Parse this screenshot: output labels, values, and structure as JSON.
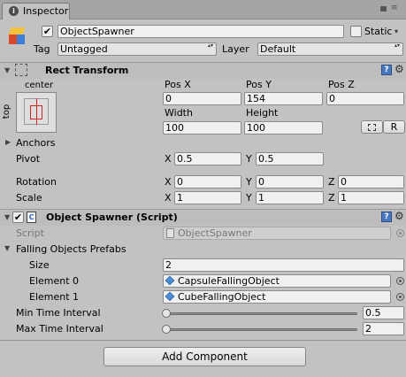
{
  "tab": {
    "title": "Inspector"
  },
  "header": {
    "object_name": "ObjectSpawner",
    "active_checked": "✔",
    "static_label": "Static",
    "tag_label": "Tag",
    "tag_value": "Untagged",
    "layer_label": "Layer",
    "layer_value": "Default"
  },
  "rect_transform": {
    "title": "Rect Transform",
    "anchor_preset_h": "center",
    "anchor_preset_v": "top",
    "pos_x_label": "Pos X",
    "pos_x": "0",
    "pos_y_label": "Pos Y",
    "pos_y": "154",
    "pos_z_label": "Pos Z",
    "pos_z": "0",
    "width_label": "Width",
    "width": "100",
    "height_label": "Height",
    "height": "100",
    "raw_button": "R",
    "anchors_label": "Anchors",
    "pivot_label": "Pivot",
    "pivot_x_label": "X",
    "pivot_x": "0.5",
    "pivot_y_label": "Y",
    "pivot_y": "0.5",
    "rotation_label": "Rotation",
    "rot_x_label": "X",
    "rot_x": "0",
    "rot_y_label": "Y",
    "rot_y": "0",
    "rot_z_label": "Z",
    "rot_z": "0",
    "scale_label": "Scale",
    "scale_x_label": "X",
    "scale_x": "1",
    "scale_y_label": "Y",
    "scale_y": "1",
    "scale_z_label": "Z",
    "scale_z": "1"
  },
  "object_spawner": {
    "title": "Object Spawner (Script)",
    "script_label": "Script",
    "script_value": "ObjectSpawner",
    "prefabs_label": "Falling Objects Prefabs",
    "size_label": "Size",
    "size_value": "2",
    "element0_label": "Element 0",
    "element0_value": "CapsuleFallingObject",
    "element1_label": "Element 1",
    "element1_value": "CubeFallingObject",
    "min_label": "Min Time Interval",
    "min_value": "0.5",
    "max_label": "Max Time Interval",
    "max_value": "2"
  },
  "add_component": "Add Component"
}
